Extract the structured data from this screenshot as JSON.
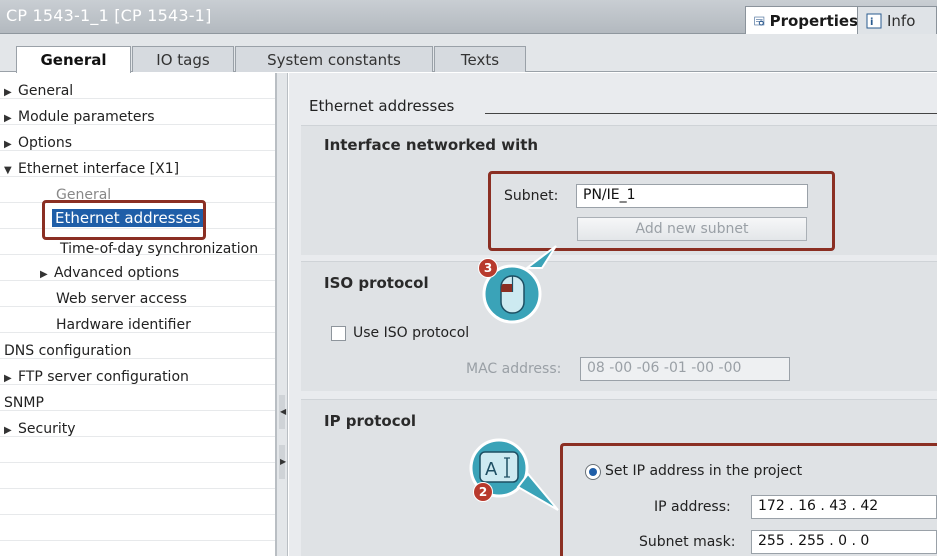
{
  "window": {
    "title": "CP 1543-1_1 [CP 1543-1]",
    "tab_properties": "Properties",
    "tab_info": "Info"
  },
  "tabs": [
    {
      "label": "General"
    },
    {
      "label": "IO tags"
    },
    {
      "label": "System constants"
    },
    {
      "label": "Texts"
    }
  ],
  "nav": {
    "items": [
      {
        "label": "General"
      },
      {
        "label": "Module parameters"
      },
      {
        "label": "Options"
      },
      {
        "label": "Ethernet interface [X1]"
      },
      {
        "label": "General"
      },
      {
        "label": "Ethernet addresses"
      },
      {
        "label": "Time-of-day synchronization"
      },
      {
        "label": "Advanced options"
      },
      {
        "label": "Web server access"
      },
      {
        "label": "Hardware identifier"
      },
      {
        "label": "DNS configuration"
      },
      {
        "label": "FTP server configuration"
      },
      {
        "label": "SNMP"
      },
      {
        "label": "Security"
      }
    ]
  },
  "content": {
    "section_title": "Ethernet addresses",
    "interface": {
      "title": "Interface networked with",
      "subnet_label": "Subnet:",
      "subnet_value": "PN/IE_1",
      "add_subnet_button": "Add new subnet"
    },
    "iso": {
      "title": "ISO protocol",
      "use_iso_label": "Use ISO protocol",
      "mac_label": "MAC address:",
      "mac_value": "08 -00 -06 -01 -00 -00"
    },
    "ip": {
      "title": "IP protocol",
      "set_ip_label": "Set IP address in the project",
      "ip_label": "IP address:",
      "ip_value": "172 . 16 . 43 . 42",
      "mask_label": "Subnet mask:",
      "mask_value": "255 . 255 . 0 . 0"
    }
  },
  "callouts": {
    "step2": "2",
    "step3": "3"
  },
  "colors": {
    "highlight": "#8b2f23",
    "selection": "#1f5ea8",
    "badge": "#b83a2d",
    "callout": "#3aa3b8"
  }
}
